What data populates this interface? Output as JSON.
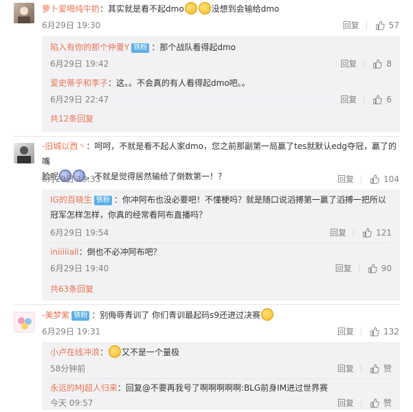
{
  "colors": {
    "link": "#eb7350",
    "meta": "#808080",
    "sub_bg": "#f2f2f5",
    "badge": "#5dafe6"
  },
  "c1": {
    "user": "萝卜爱喝纯牛奶",
    "text_a": "：其实就是看不起dmo",
    "text_b": "没想到会输给dmo",
    "time": "6月29日 19:30",
    "reply": "回复",
    "likes": "57",
    "subs": [
      {
        "user": "陷入有你的那个仲夏Y",
        "badge": "铁粉",
        "text": "：那个战队看得起dmo",
        "time": "6月29日 19:42",
        "reply": "回复",
        "likes": "8"
      },
      {
        "user": "爱史蒂乎和李子",
        "text": "：这。。不会真的有人看得起dmo吧。。",
        "time": "6月29日 22:47",
        "reply": "回复",
        "likes": "6"
      }
    ],
    "more": "共12条回复"
  },
  "c2": {
    "user": "-旧城以西丶",
    "text_a": "：呵呵，不就是看不起人家dmo，您之前那副第一局赢了tes就默认edg夺冠，赢了的嘴",
    "text_b": "脸呢",
    "text_c": "，不就是觉得居然输给了倒数第一！？",
    "time": "6月29日 19:33",
    "reply": "回复",
    "likes": "104",
    "subs": [
      {
        "user": "IG的百晓生",
        "badge": "铁粉",
        "text_a": "：你冲阿布也没必要吧！不懂梗吗？就是随口说滔搏第一赢了滔搏一把所以",
        "text_b": "冠军怎样怎样，你真的经常看阿布直播吗？",
        "time": "6月29日 19:54",
        "reply": "回复",
        "likes": "121"
      },
      {
        "user": "iniiiiiall",
        "text": "：倒也不必冲阿布吧？",
        "time": "6月29日 19:40",
        "reply": "回复",
        "likes": "90"
      }
    ],
    "more": "共63条回复"
  },
  "c3": {
    "user": "-美梦紫",
    "badge": "铁粉",
    "text": "：别侮辱青训了 你们青训最起码s9还进过决赛",
    "time": "6月29日 19:31",
    "reply": "回复",
    "likes": "132",
    "subs": [
      {
        "user": "小卢在线冲浪",
        "text": "：",
        "text_b": "又不是一个量极",
        "time": "58分钟前",
        "reply": "回复",
        "likes": "赞"
      },
      {
        "user": "永远的MJ超人归来",
        "text": "：回复@不要再我号了啊啊啊啊啊:BLG前身IM进过世界赛",
        "time": "今天 09:57",
        "reply": "回复",
        "likes": "赞"
      }
    ]
  },
  "icons": {
    "like": "thumb-up-icon"
  }
}
